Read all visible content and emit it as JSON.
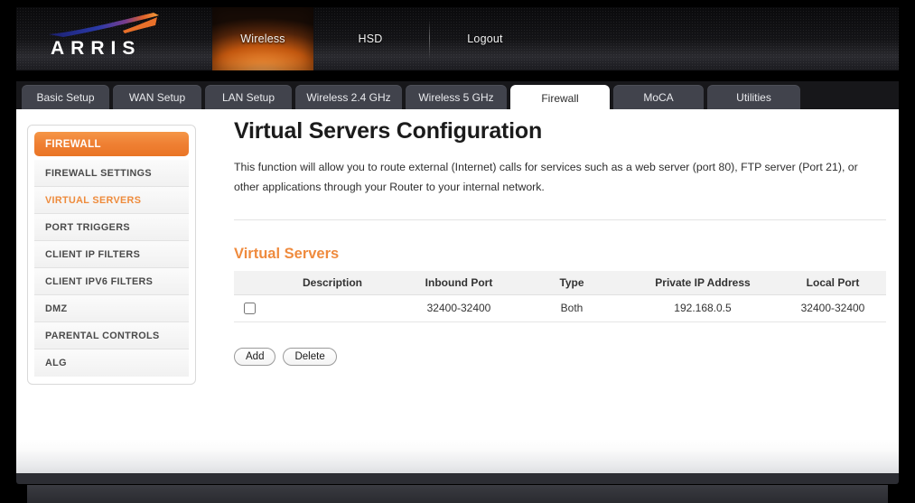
{
  "brand": {
    "logo_text": "ARRIS"
  },
  "header_nav": [
    {
      "label": "Wireless",
      "active": true
    },
    {
      "label": "HSD",
      "active": false
    },
    {
      "label": "Logout",
      "active": false
    }
  ],
  "tabs": [
    {
      "label": "Basic Setup",
      "active": false
    },
    {
      "label": "WAN Setup",
      "active": false
    },
    {
      "label": "LAN Setup",
      "active": false
    },
    {
      "label": "Wireless 2.4 GHz",
      "active": false
    },
    {
      "label": "Wireless 5 GHz",
      "active": false
    },
    {
      "label": "Firewall",
      "active": true
    },
    {
      "label": "MoCA",
      "active": false
    },
    {
      "label": "Utilities",
      "active": false
    }
  ],
  "sidebar": {
    "header": "FIREWALL",
    "items": [
      {
        "label": "FIREWALL SETTINGS",
        "selected": false
      },
      {
        "label": "VIRTUAL SERVERS",
        "selected": true
      },
      {
        "label": "PORT TRIGGERS",
        "selected": false
      },
      {
        "label": "CLIENT IP FILTERS",
        "selected": false
      },
      {
        "label": "CLIENT IPV6 FILTERS",
        "selected": false
      },
      {
        "label": "DMZ",
        "selected": false
      },
      {
        "label": "PARENTAL CONTROLS",
        "selected": false
      },
      {
        "label": "ALG",
        "selected": false
      }
    ]
  },
  "main": {
    "title": "Virtual Servers Configuration",
    "description": "This function will allow you to route external (Internet) calls for services such as a web server (port 80), FTP server (Port 21), or other applications through your Router to your internal network.",
    "section_title": "Virtual Servers",
    "table": {
      "columns": [
        "",
        "Description",
        "Inbound Port",
        "Type",
        "Private IP Address",
        "Local Port"
      ],
      "rows": [
        {
          "checked": false,
          "description": "",
          "inbound_port": "32400-32400",
          "type": "Both",
          "private_ip": "192.168.0.5",
          "local_port": "32400-32400"
        }
      ]
    },
    "buttons": {
      "add": "Add",
      "delete": "Delete"
    }
  },
  "colors": {
    "accent_orange": "#ef8b3e",
    "header_dark": "#141417",
    "tab_inactive": "#41434c"
  }
}
